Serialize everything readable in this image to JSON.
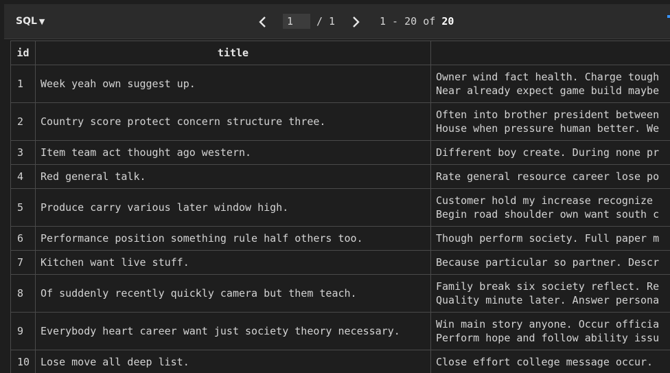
{
  "toolbar": {
    "mode_label": "SQL",
    "page_value": "1",
    "page_total": "/ 1",
    "range_prefix": "1 - 20 of ",
    "range_total": "20"
  },
  "table": {
    "columns": [
      "id",
      "title",
      ""
    ],
    "rows": [
      {
        "id": "1",
        "title": "Week yeah own suggest up.",
        "body": "Owner wind fact health. Charge tough\nNear already expect game build maybe"
      },
      {
        "id": "2",
        "title": "Country score protect concern structure three.",
        "body": "Often into brother president between\nHouse when pressure human better. We"
      },
      {
        "id": "3",
        "title": "Item team act thought ago western.",
        "body": "Different boy create. During none pr"
      },
      {
        "id": "4",
        "title": "Red general talk.",
        "body": "Rate general resource career lose po"
      },
      {
        "id": "5",
        "title": "Produce carry various later window high.",
        "body": "Customer hold my increase recognize\nBegin road shoulder own want south c"
      },
      {
        "id": "6",
        "title": "Performance position something rule half others too.",
        "body": "Though perform society. Full paper m"
      },
      {
        "id": "7",
        "title": "Kitchen want live stuff.",
        "body": "Because particular so partner. Descr"
      },
      {
        "id": "8",
        "title": "Of suddenly recently quickly camera but them teach.",
        "body": "Family break six society reflect. Re\nQuality minute later. Answer persona"
      },
      {
        "id": "9",
        "title": "Everybody heart career want just society theory necessary.",
        "body": "Win main story anyone. Occur officia\nPerform hope and follow ability issu"
      },
      {
        "id": "10",
        "title": "Lose move all deep list.",
        "body": "Close effort college message occur."
      }
    ]
  },
  "colors": {
    "background": "#1e1e1e",
    "toolbar": "#2b2b2b",
    "border": "#4a4a4a",
    "text": "#d4d4d4",
    "accent": "#3794ff"
  },
  "icons": {
    "prev": "chevron-left-icon",
    "next": "chevron-right-icon",
    "mode_caret": "caret-down-icon"
  }
}
